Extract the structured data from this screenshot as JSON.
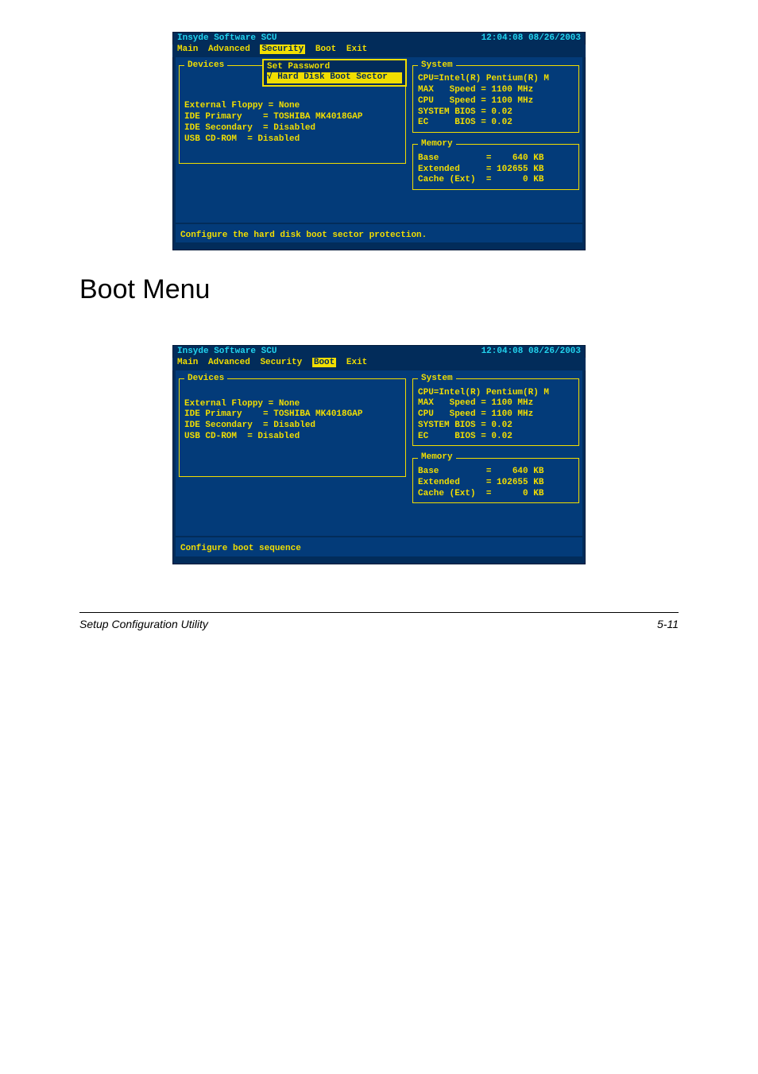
{
  "bios_common": {
    "product": "Insyde Software SCU",
    "datetime": "12:04:08  08/26/2003",
    "menu": {
      "main": "Main",
      "advanced": "Advanced",
      "security": "Security",
      "boot": "Boot",
      "exit": "Exit"
    },
    "devices_title": "Devices",
    "devices_lines": "External Floppy = None\nIDE Primary    = TOSHIBA MK4018GAP\nIDE Secondary  = Disabled\nUSB CD-ROM  = Disabled",
    "system_title": "System",
    "system_lines": "CPU=Intel(R) Pentium(R) M\nMAX   Speed = 1100 MHz\nCPU   Speed = 1100 MHz\nSYSTEM BIOS = 0.02\nEC     BIOS = 0.02",
    "memory_title": "Memory",
    "memory_lines": "Base         =    640 KB\nExtended     = 102655 KB\nCache (Ext)  =      0 KB"
  },
  "screen1": {
    "dropdown": {
      "item1": "Set Password",
      "item2": "√ Hard Disk Boot Sector"
    },
    "help": "Configure the hard disk boot sector protection."
  },
  "section_heading": "Boot Menu",
  "screen2": {
    "help": "Configure boot sequence"
  },
  "footer": {
    "left": "Setup Configuration Utility",
    "right": "5-11"
  }
}
